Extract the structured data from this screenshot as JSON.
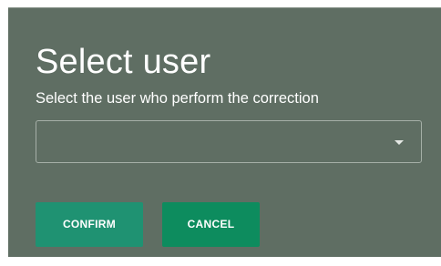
{
  "dialog": {
    "title": "Select user",
    "subtitle": "Select the user who perform the correction",
    "select": {
      "value": "",
      "icon": "caret-down-icon"
    },
    "buttons": {
      "confirm_label": "CONFIRM",
      "cancel_label": "CANCEL"
    }
  },
  "colors": {
    "dialog_background": "#5f6e63",
    "confirm_button": "#1f9272",
    "cancel_button": "#0d8c5e",
    "text": "#ffffff"
  }
}
